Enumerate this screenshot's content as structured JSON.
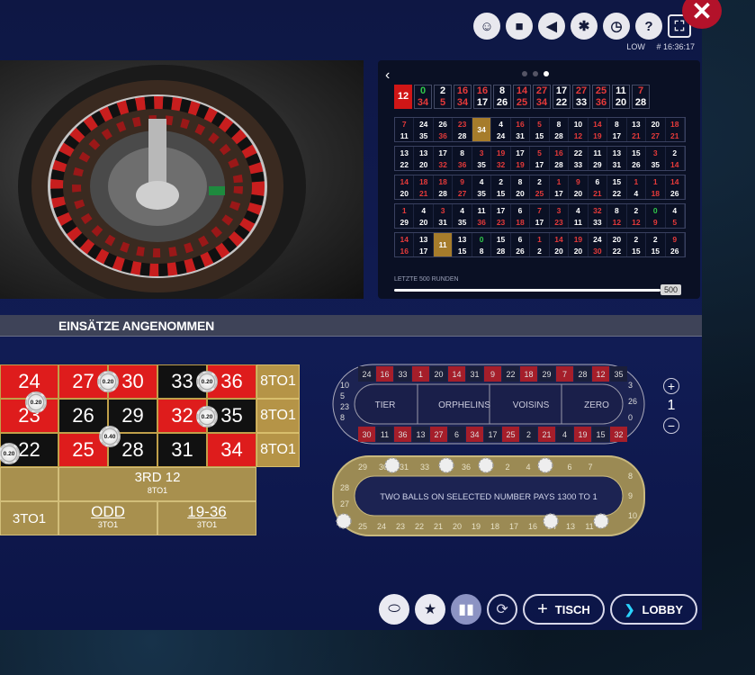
{
  "window": {
    "close_label": "✕"
  },
  "topbar": {
    "icons": [
      "accessibility-icon",
      "camera-icon",
      "volume-icon",
      "settings-icon",
      "history-icon",
      "help-icon",
      "fullscreen-icon"
    ],
    "limit": "LOW",
    "table_time": "# 16:36:17"
  },
  "stats": {
    "last_numbers": [
      {
        "top": "12",
        "bottom": "",
        "style": "red-fill"
      },
      {
        "top": "0",
        "bottom": "34",
        "tc": "g",
        "bc": "r"
      },
      {
        "top": "2",
        "bottom": "5",
        "tc": "w",
        "bc": "r"
      },
      {
        "top": "16",
        "bottom": "34",
        "tc": "r",
        "bc": "r"
      },
      {
        "top": "16",
        "bottom": "17",
        "tc": "r",
        "bc": "w"
      },
      {
        "top": "8",
        "bottom": "26",
        "tc": "w",
        "bc": "w"
      },
      {
        "top": "14",
        "bottom": "25",
        "tc": "r",
        "bc": "r"
      },
      {
        "top": "27",
        "bottom": "34",
        "tc": "r",
        "bc": "r"
      },
      {
        "top": "17",
        "bottom": "22",
        "tc": "w",
        "bc": "w"
      },
      {
        "top": "27",
        "bottom": "33",
        "tc": "r",
        "bc": "w"
      },
      {
        "top": "25",
        "bottom": "36",
        "tc": "r",
        "bc": "r"
      },
      {
        "top": "11",
        "bottom": "20",
        "tc": "w",
        "bc": "w"
      },
      {
        "top": "7",
        "bottom": "28",
        "tc": "r",
        "bc": "w"
      }
    ],
    "history_rows": [
      [
        "7",
        "24",
        "26",
        "23",
        "34*",
        "4",
        "16",
        "5",
        "8",
        "10",
        "14",
        "8",
        "13",
        "20",
        "18",
        "11",
        "35",
        "36",
        "28",
        "24",
        "31",
        "15",
        "28",
        "12",
        "19",
        "17",
        "21",
        "27",
        "21"
      ],
      [
        "13",
        "13",
        "17",
        "8",
        "3",
        "19",
        "17",
        "5",
        "16",
        "22",
        "11",
        "13",
        "15",
        "3",
        "2",
        "22",
        "20",
        "32",
        "36",
        "35",
        "32",
        "19",
        "17",
        "28",
        "33",
        "29",
        "31",
        "26",
        "35",
        "14"
      ],
      [
        "14",
        "18",
        "18",
        "9",
        "4",
        "2",
        "8",
        "2",
        "1",
        "9",
        "6",
        "15",
        "1",
        "1",
        "14",
        "20",
        "21",
        "28",
        "27",
        "35",
        "15",
        "20",
        "25",
        "17",
        "20",
        "21",
        "22",
        "4",
        "18",
        "26"
      ],
      [
        "1",
        "4",
        "3",
        "4",
        "11",
        "17",
        "6",
        "7",
        "3",
        "4",
        "32",
        "8",
        "2",
        "0",
        "4",
        "29",
        "20",
        "31",
        "35",
        "36",
        "23",
        "18",
        "17",
        "23",
        "11",
        "33",
        "12",
        "12",
        "9",
        "5"
      ],
      [
        "14",
        "13",
        "11*",
        "13",
        "0",
        "15",
        "6",
        "1",
        "14",
        "19",
        "24",
        "20",
        "2",
        "2",
        "9",
        "16",
        "17",
        "15",
        "8",
        "28",
        "26",
        "2",
        "20",
        "20",
        "30",
        "22",
        "15",
        "15",
        "26"
      ]
    ],
    "label": "LETZTE 500 RUNDEN",
    "slider_value": "500"
  },
  "banner": {
    "text": "EINSÄTZE ANGENOMMEN"
  },
  "table": {
    "row1": [
      "24",
      "27",
      "30",
      "33",
      "36"
    ],
    "row2": [
      "23",
      "26",
      "29",
      "32",
      "35"
    ],
    "row3": [
      "22",
      "25",
      "28",
      "31",
      "34"
    ],
    "two_to_one": "8TO1",
    "dozen3": "3RD 12",
    "dozen3_payout": "8TO1",
    "odd": "ODD",
    "odd_payout": "3TO1",
    "high": "19-36",
    "high_payout": "3TO1",
    "low_payout": "3TO1",
    "chips": [
      "0.20",
      "0.20",
      "0.20",
      "0.20",
      "0.40",
      "0.20"
    ]
  },
  "racetrack": {
    "top": [
      "24",
      "16",
      "33",
      "1",
      "20",
      "14",
      "31",
      "9",
      "22",
      "18",
      "29",
      "7",
      "28",
      "12",
      "35"
    ],
    "bottom": [
      "30",
      "11",
      "36",
      "13",
      "27",
      "6",
      "34",
      "17",
      "25",
      "2",
      "21",
      "4",
      "19",
      "15",
      "32"
    ],
    "left": [
      "10",
      "5",
      "23",
      "8"
    ],
    "right": [
      "3",
      "26",
      "0"
    ],
    "sections": [
      "TIER",
      "ORPHELINS",
      "VOISINS",
      "ZERO"
    ],
    "bonus_text": "TWO BALLS ON SELECTED NUMBER PAYS 1300 TO 1",
    "bonus_top": [
      "29",
      "30",
      "31",
      "33",
      "34",
      "36",
      "1",
      "2",
      "4",
      "5",
      "6",
      "7"
    ],
    "bonus_bottom": [
      "25",
      "24",
      "23",
      "22",
      "21",
      "20",
      "19",
      "18",
      "17",
      "16",
      "14",
      "13",
      "11"
    ],
    "bonus_left": [
      "28",
      "27"
    ],
    "bonus_right": [
      "8",
      "9",
      "10"
    ]
  },
  "zoom": {
    "level": "1",
    "plus": "+",
    "minus": "−"
  },
  "bottom": {
    "table_label": "TISCH",
    "lobby_label": "LOBBY",
    "plus": "+"
  }
}
